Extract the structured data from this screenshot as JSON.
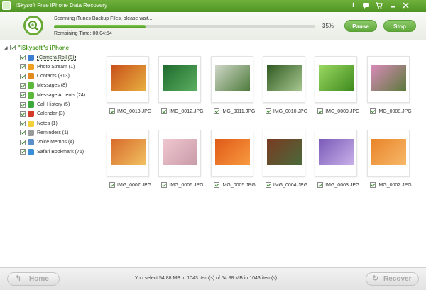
{
  "window": {
    "title": "iSkysoft Free iPhone Data Recovery",
    "icons": [
      "facebook-icon",
      "feedback-icon",
      "cart-icon",
      "minimize-icon",
      "close-icon"
    ]
  },
  "header": {
    "scan_text": "Scanning iTunes Backup Files, please wait...",
    "progress": 0.35,
    "percent_label": "35%",
    "remaining": "Remaining Time: 00:04:54",
    "pause_label": "Pause",
    "stop_label": "Stop"
  },
  "sidebar": {
    "device": "\"iSkysoft\"s iPhone",
    "items": [
      {
        "label": "Camera Roll (8)",
        "color": "#3d7fd1",
        "icon": "camera-roll-icon"
      },
      {
        "label": "Photo Stream (1)",
        "color": "#f0a020",
        "icon": "photo-stream-icon"
      },
      {
        "label": "Contacts (913)",
        "color": "#e08a20",
        "icon": "contacts-icon"
      },
      {
        "label": "Messages (8)",
        "color": "#5cb83a",
        "icon": "messages-icon"
      },
      {
        "label": "Message A...ents (24)",
        "color": "#5cb83a",
        "icon": "message-attachments-icon"
      },
      {
        "label": "Call History (5)",
        "color": "#3aa83a",
        "icon": "call-history-icon"
      },
      {
        "label": "Calendar (3)",
        "color": "#d23a2a",
        "icon": "calendar-icon"
      },
      {
        "label": "Notes (1)",
        "color": "#f2d03a",
        "icon": "notes-icon"
      },
      {
        "label": "Reminders (1)",
        "color": "#9a9a9a",
        "icon": "reminders-icon"
      },
      {
        "label": "Voice Memos (4)",
        "color": "#5a8fc9",
        "icon": "voice-memos-icon"
      },
      {
        "label": "Safari Bookmark (75)",
        "color": "#3a8fd9",
        "icon": "safari-bookmark-icon"
      }
    ]
  },
  "photos": [
    {
      "name": "IMG_0013.JPG",
      "colors": [
        "#c8501a",
        "#e8b040"
      ]
    },
    {
      "name": "IMG_0012.JPG",
      "colors": [
        "#1f6a2e",
        "#5cb060"
      ]
    },
    {
      "name": "IMG_0011.JPG",
      "colors": [
        "#cfd7c8",
        "#4d7a3a"
      ]
    },
    {
      "name": "IMG_0010.JPG",
      "colors": [
        "#2f5a22",
        "#a8c890"
      ]
    },
    {
      "name": "IMG_0009.JPG",
      "colors": [
        "#9ad860",
        "#3e8a1e"
      ]
    },
    {
      "name": "IMG_0008.JPG",
      "colors": [
        "#d88ab8",
        "#5a7a3a"
      ]
    },
    {
      "name": "IMG_0007.JPG",
      "colors": [
        "#d86a2a",
        "#f0c060"
      ]
    },
    {
      "name": "IMG_0006.JPG",
      "colors": [
        "#f0c8d0",
        "#c89aa8"
      ]
    },
    {
      "name": "IMG_0005.JPG",
      "colors": [
        "#e05a18",
        "#f89a40"
      ]
    },
    {
      "name": "IMG_0004.JPG",
      "colors": [
        "#7a3a22",
        "#4a6a3a"
      ]
    },
    {
      "name": "IMG_0003.JPG",
      "colors": [
        "#7a5ab8",
        "#c8b0e8"
      ]
    },
    {
      "name": "IMG_0002.JPG",
      "colors": [
        "#e8842a",
        "#f8b868"
      ]
    }
  ],
  "bottom": {
    "home_label": "Home",
    "status": "You select 54.88 MB in 1043 item(s) of 54.88 MB in 1043 item(s)",
    "recover_label": "Recover"
  }
}
